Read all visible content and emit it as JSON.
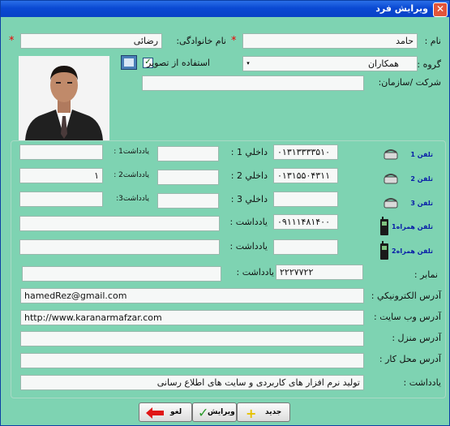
{
  "window": {
    "title": "ويرايش فرد"
  },
  "form": {
    "first_name_label": "نام :",
    "first_name_value": "حامد",
    "last_name_label": "نام خانوادگی:",
    "last_name_value": "رضائی",
    "group_label": "گروه :",
    "group_value": "همكاران",
    "use_image_label": "استفاده از تصوير",
    "company_label": "شرکت /سازمان:",
    "company_value": "",
    "phones": [
      {
        "label": "تلفن 1",
        "value": "۰۱۳۱۳۳۳۳۵۱۰",
        "ext_label": "داخلي 1 :",
        "ext_value": "",
        "note_label": "يادداشت1 :",
        "note_value": ""
      },
      {
        "label": "تلفن 2",
        "value": "۰۱۳۱۵۵۰۴۳۱۱",
        "ext_label": "داخلي 2 :",
        "ext_value": "",
        "note_label": "يادداشت2 :",
        "note_value": "۱"
      },
      {
        "label": "تلفن 3",
        "value": "",
        "ext_label": "داخلي 3 :",
        "ext_value": "",
        "note_label": "يادداشت3:",
        "note_value": ""
      }
    ],
    "mobiles": [
      {
        "label": "تلفن همراه1",
        "value": "۰۹۱۱۱۴۸۱۴۰۰",
        "note_label": "يادداشت :",
        "note_value": ""
      },
      {
        "label": "تلفن همراه2",
        "value": "",
        "note_label": "يادداشت :",
        "note_value": ""
      }
    ],
    "fax": {
      "label": "نمابر :",
      "value": "۲۲۲۷۷۲۲",
      "note_label": "يادداشت :",
      "note_value": ""
    },
    "email": {
      "label": "آدرس الكترونيكي :",
      "value": "hamedRez@gmail.com"
    },
    "website": {
      "label": "آدرس وب سايت :",
      "value": "http://www.karanarmafzar.com"
    },
    "home_address": {
      "label": "آدرس منزل :",
      "value": ""
    },
    "work_address": {
      "label": "آدرس محل کار :",
      "value": ""
    },
    "note": {
      "label": "يادداشت :",
      "value": "تولید نرم افزار های کاربردی و سایت های اطلاع رسانی"
    }
  },
  "buttons": {
    "new": "جديد",
    "edit": "ويرايش",
    "cancel": "لغو"
  },
  "colors": {
    "background": "#7ed3b2",
    "title_bar": "#0a49d3",
    "required_star": "#e00000"
  }
}
